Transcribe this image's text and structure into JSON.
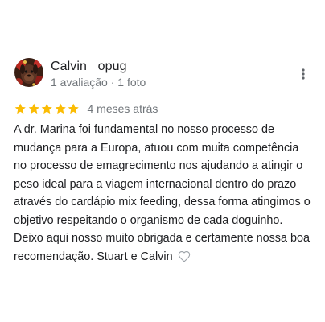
{
  "review": {
    "author": {
      "name": "Calvin _opug",
      "meta": "1 avaliação · 1 foto",
      "avatar": "dog-photo-avatar"
    },
    "rating": {
      "stars": 5,
      "max": 5,
      "star_color": "#fbbc04"
    },
    "date": "4 meses atrás",
    "text": "A dr. Marina foi fundamental no nosso processo de mudança para a Europa, atuou com muita competência no processo de emagrecimento nos ajudando a atingir o peso ideal para a viagem internacional dentro do prazo através do cardápio mix feeding, dessa forma atingimos o objetivo respeitando o organismo de cada doguinho. Deixo aqui nosso muito obrigada e certamente nossa boa recomendação. Stuart e Calvin",
    "icons": {
      "menu": "more-vert-icon",
      "like": "heart-outline-icon"
    }
  }
}
